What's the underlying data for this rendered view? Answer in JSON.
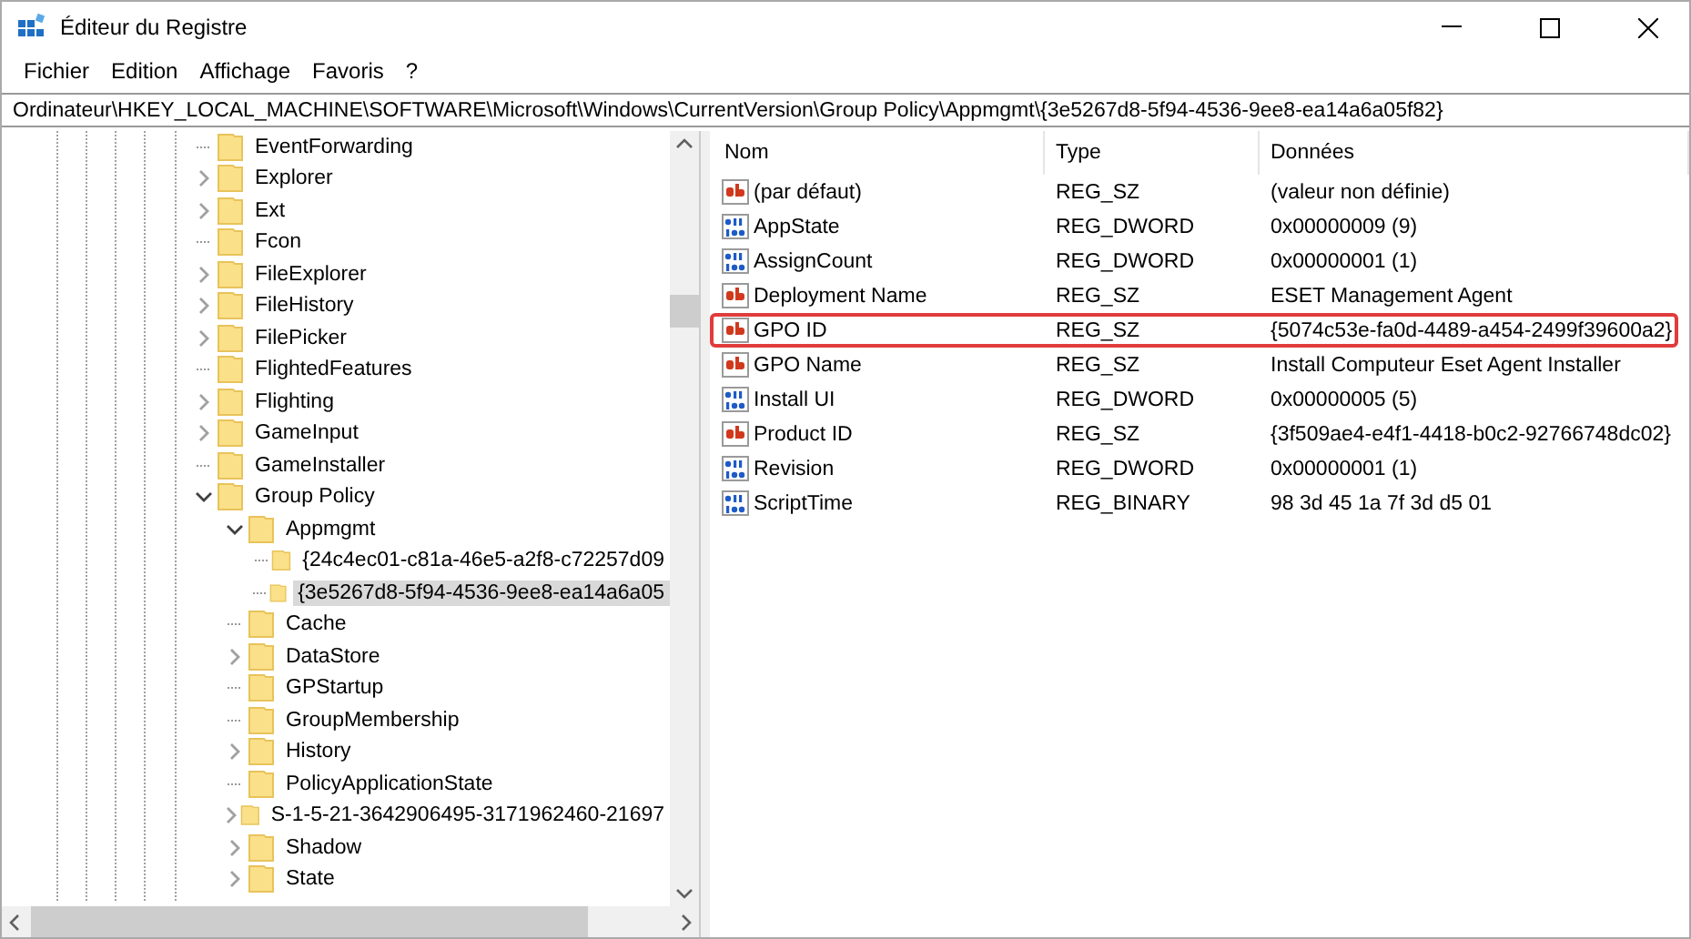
{
  "window": {
    "title": "Éditeur du Registre"
  },
  "menu": [
    "Fichier",
    "Edition",
    "Affichage",
    "Favoris",
    "?"
  ],
  "address": "Ordinateur\\HKEY_LOCAL_MACHINE\\SOFTWARE\\Microsoft\\Windows\\CurrentVersion\\Group Policy\\Appmgmt\\{3e5267d8-5f94-4536-9ee8-ea14a6a05f82}",
  "tree": [
    {
      "label": "EventForwarding",
      "has_children": false,
      "selected": false
    },
    {
      "label": "Explorer",
      "has_children": true,
      "expanded": false,
      "selected": false
    },
    {
      "label": "Ext",
      "has_children": true,
      "expanded": false,
      "selected": false
    },
    {
      "label": "Fcon",
      "has_children": false,
      "selected": false
    },
    {
      "label": "FileExplorer",
      "has_children": true,
      "expanded": false,
      "selected": false
    },
    {
      "label": "FileHistory",
      "has_children": true,
      "expanded": false,
      "selected": false
    },
    {
      "label": "FilePicker",
      "has_children": true,
      "expanded": false,
      "selected": false
    },
    {
      "label": "FlightedFeatures",
      "has_children": false,
      "selected": false
    },
    {
      "label": "Flighting",
      "has_children": true,
      "expanded": false,
      "selected": false
    },
    {
      "label": "GameInput",
      "has_children": true,
      "expanded": false,
      "selected": false
    },
    {
      "label": "GameInstaller",
      "has_children": false,
      "selected": false
    },
    {
      "label": "Group Policy",
      "has_children": true,
      "expanded": true,
      "selected": false,
      "children": [
        {
          "label": "Appmgmt",
          "has_children": true,
          "expanded": true,
          "selected": false,
          "children": [
            {
              "label": "{24c4ec01-c81a-46e5-a2f8-c72257d09",
              "has_children": false,
              "selected": false
            },
            {
              "label": "{3e5267d8-5f94-4536-9ee8-ea14a6a05",
              "has_children": false,
              "selected": true
            }
          ]
        },
        {
          "label": "Cache",
          "has_children": false,
          "selected": false
        },
        {
          "label": "DataStore",
          "has_children": true,
          "expanded": false,
          "selected": false
        },
        {
          "label": "GPStartup",
          "has_children": false,
          "selected": false
        },
        {
          "label": "GroupMembership",
          "has_children": false,
          "selected": false
        },
        {
          "label": "History",
          "has_children": true,
          "expanded": false,
          "selected": false
        },
        {
          "label": "PolicyApplicationState",
          "has_children": false,
          "selected": false
        },
        {
          "label": "S-1-5-21-3642906495-3171962460-21697",
          "has_children": true,
          "expanded": false,
          "selected": false
        },
        {
          "label": "Shadow",
          "has_children": true,
          "expanded": false,
          "selected": false
        },
        {
          "label": "State",
          "has_children": true,
          "expanded": false,
          "selected": false
        }
      ]
    }
  ],
  "values": {
    "columns": [
      "Nom",
      "Type",
      "Données"
    ],
    "rows": [
      {
        "kind": "string",
        "name": "(par défaut)",
        "type": "REG_SZ",
        "data": "(valeur non définie)",
        "highlighted": false
      },
      {
        "kind": "binary",
        "name": "AppState",
        "type": "REG_DWORD",
        "data": "0x00000009 (9)",
        "highlighted": false
      },
      {
        "kind": "binary",
        "name": "AssignCount",
        "type": "REG_DWORD",
        "data": "0x00000001 (1)",
        "highlighted": false
      },
      {
        "kind": "string",
        "name": "Deployment Name",
        "type": "REG_SZ",
        "data": "ESET Management Agent",
        "highlighted": false
      },
      {
        "kind": "string",
        "name": "GPO ID",
        "type": "REG_SZ",
        "data": "{5074c53e-fa0d-4489-a454-2499f39600a2}",
        "highlighted": true
      },
      {
        "kind": "string",
        "name": "GPO Name",
        "type": "REG_SZ",
        "data": "Install Computeur Eset Agent Installer",
        "highlighted": false
      },
      {
        "kind": "binary",
        "name": "Install UI",
        "type": "REG_DWORD",
        "data": "0x00000005 (5)",
        "highlighted": false
      },
      {
        "kind": "string",
        "name": "Product ID",
        "type": "REG_SZ",
        "data": "{3f509ae4-e4f1-4418-b0c2-92766748dc02}",
        "highlighted": false
      },
      {
        "kind": "binary",
        "name": "Revision",
        "type": "REG_DWORD",
        "data": "0x00000001 (1)",
        "highlighted": false
      },
      {
        "kind": "binary",
        "name": "ScriptTime",
        "type": "REG_BINARY",
        "data": "98 3d 45 1a 7f 3d d5 01",
        "highlighted": false
      }
    ]
  }
}
